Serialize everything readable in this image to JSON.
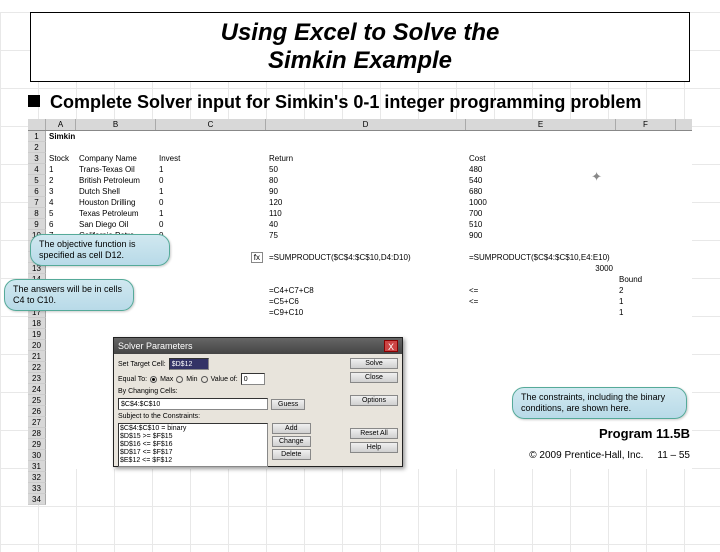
{
  "title_line1": "Using Excel to Solve the",
  "title_line2": "Simkin Example",
  "subtitle": "Complete Solver input for Simkin's 0-1 integer programming problem",
  "columns": [
    "A",
    "B",
    "C",
    "D",
    "E",
    "F"
  ],
  "a1": "Simkin",
  "headers": {
    "stock": "Stock",
    "company": "Company Name",
    "invest": "Invest",
    "return": "Return",
    "cost": "Cost"
  },
  "rows": [
    {
      "n": "1",
      "co": "Trans-Texas Oil",
      "inv": "1",
      "ret": "50",
      "cost": "480"
    },
    {
      "n": "2",
      "co": "British Petroleum",
      "inv": "0",
      "ret": "80",
      "cost": "540"
    },
    {
      "n": "3",
      "co": "Dutch Shell",
      "inv": "1",
      "ret": "90",
      "cost": "680"
    },
    {
      "n": "4",
      "co": "Houston Drilling",
      "inv": "0",
      "ret": "120",
      "cost": "1000"
    },
    {
      "n": "5",
      "co": "Texas Petroleum",
      "inv": "1",
      "ret": "110",
      "cost": "700"
    },
    {
      "n": "6",
      "co": "San Diego Oil",
      "inv": "0",
      "ret": "40",
      "cost": "510"
    },
    {
      "n": "7",
      "co": "California Petro",
      "inv": "0",
      "ret": "75",
      "cost": "900"
    }
  ],
  "fx_label": "fx",
  "sumprod1": "=SUMPRODUCT($C$4:$C$10,D4:D10)",
  "sumprod2": "=SUMPRODUCT($C$4:$C$10,E4:E10)",
  "budget": "3000",
  "bound_label": "Bound",
  "constraints": [
    {
      "d": "=C4+C7+C8",
      "e": "<=",
      "f": "2"
    },
    {
      "d": "=C5+C6",
      "e": "<=",
      "f": "1"
    },
    {
      "d": "=C9+C10",
      "e": "",
      "f": "1"
    }
  ],
  "callouts": {
    "obj": "The objective function is specified as cell D12.",
    "ans": "The answers will be in cells C4 to C10.",
    "con": "The constraints, including the binary conditions, are shown here."
  },
  "solver": {
    "title": "Solver Parameters",
    "target_label": "Set Target Cell:",
    "target": "$D$12",
    "equal_label": "Equal To:",
    "max": "Max",
    "min": "Min",
    "value_of": "Value of:",
    "value": "0",
    "changing_label": "By Changing Cells:",
    "changing": "$C$4:$C$10",
    "subject_label": "Subject to the Constraints:",
    "constraints_list": [
      "$C$4:$C$10 = binary",
      "$D$15 >= $F$15",
      "$D$16 <= $F$16",
      "$D$17 <= $F$17",
      "$E$12 <= $F$12"
    ],
    "btn_solve": "Solve",
    "btn_close": "Close",
    "btn_guess": "Guess",
    "btn_options": "Options",
    "btn_add": "Add",
    "btn_change": "Change",
    "btn_delete": "Delete",
    "btn_reset": "Reset All",
    "btn_help": "Help"
  },
  "program_label": "Program 11.5B",
  "copyright": "© 2009 Prentice-Hall, Inc.",
  "page": "11 – 55"
}
